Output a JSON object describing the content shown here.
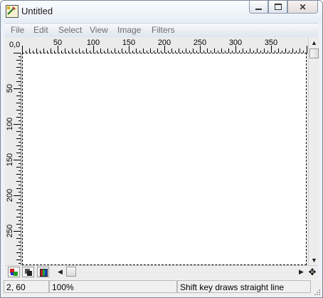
{
  "window": {
    "title": "Untitled",
    "icon": "paint-brush-icon",
    "controls": {
      "minimize": "minimize-icon",
      "maximize": "restore-icon",
      "close": "close-icon"
    }
  },
  "menu": {
    "items": [
      {
        "label": "File"
      },
      {
        "label": "Edit"
      },
      {
        "label": "Select"
      },
      {
        "label": "View"
      },
      {
        "label": "Image"
      },
      {
        "label": "Filters"
      }
    ]
  },
  "rulers": {
    "origin_label": "0,0",
    "horizontal_labels": [
      "50",
      "100",
      "150",
      "200",
      "250",
      "300",
      "350"
    ],
    "vertical_labels": [
      "50",
      "100",
      "150",
      "200",
      "250"
    ]
  },
  "status": {
    "coordinates": "2, 60",
    "zoom": "100%",
    "hint": "Shift key draws straight line"
  },
  "colors": {
    "accent": "#7a8899",
    "menu_text_disabled": "#6d6d6d",
    "canvas": "#ffffff"
  }
}
